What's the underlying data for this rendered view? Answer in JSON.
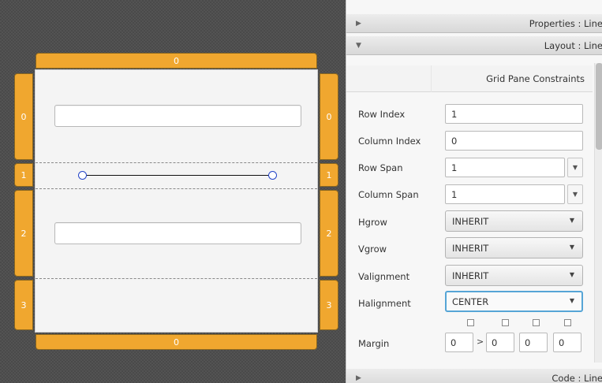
{
  "canvas": {
    "columns": [
      "0"
    ],
    "columns_bottom": [
      "0"
    ],
    "rows_left": [
      "0",
      "1",
      "2",
      "3"
    ],
    "rows_right": [
      "0",
      "1",
      "2",
      "3"
    ]
  },
  "inspector": {
    "sections": [
      {
        "label": "Properties : Line",
        "expanded": false
      },
      {
        "label": "Layout : Line",
        "expanded": true
      },
      {
        "label": "Code : Line",
        "expanded": false
      }
    ],
    "subtab": "Grid Pane Constraints",
    "fields": {
      "row_index": {
        "label": "Row Index",
        "value": "1"
      },
      "column_index": {
        "label": "Column Index",
        "value": "0"
      },
      "row_span": {
        "label": "Row Span",
        "value": "1"
      },
      "column_span": {
        "label": "Column Span",
        "value": "1"
      },
      "hgrow": {
        "label": "Hgrow",
        "value": "INHERIT"
      },
      "vgrow": {
        "label": "Vgrow",
        "value": "INHERIT"
      },
      "valignment": {
        "label": "Valignment",
        "value": "INHERIT"
      },
      "halignment": {
        "label": "Halignment",
        "value": "CENTER"
      },
      "margin": {
        "label": "Margin",
        "values": [
          "0",
          "0",
          "0",
          "0"
        ]
      }
    },
    "icons": {
      "collapsed": "triangle-right-icon",
      "expanded": "triangle-down-icon",
      "dropdown": "chevron-down-icon",
      "link": "chevron-right-icon"
    }
  }
}
